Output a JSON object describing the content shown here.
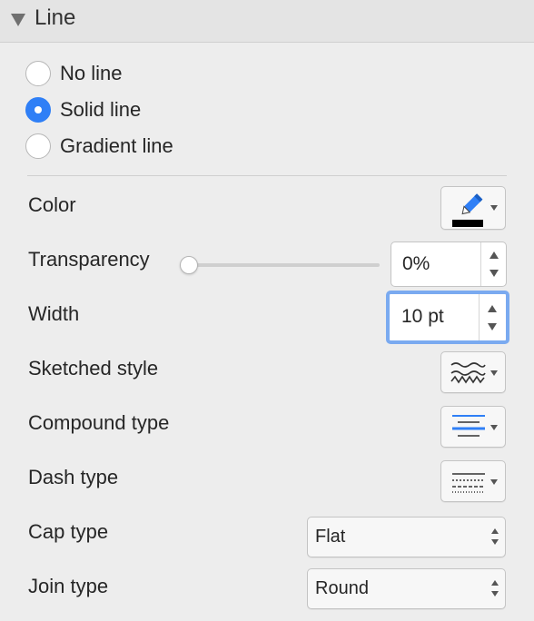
{
  "section": {
    "title": "Line"
  },
  "line_options": [
    {
      "label": "No line",
      "checked": false
    },
    {
      "label": "Solid line",
      "checked": true
    },
    {
      "label": "Gradient line",
      "checked": false
    }
  ],
  "color": {
    "label": "Color",
    "icon": "pen-icon",
    "value": "#000000"
  },
  "transparency": {
    "label": "Transparency",
    "value": "0%",
    "slider_fraction": 0.0
  },
  "width": {
    "label": "Width",
    "value": "10 pt"
  },
  "sketched": {
    "label": "Sketched style",
    "icon": "squiggle-lines-icon"
  },
  "compound": {
    "label": "Compound type",
    "icon": "compound-lines-icon"
  },
  "dash": {
    "label": "Dash type",
    "icon": "dash-lines-icon"
  },
  "cap": {
    "label": "Cap type",
    "value": "Flat"
  },
  "join": {
    "label": "Join type",
    "value": "Round"
  },
  "colors": {
    "accent": "#2f7ff6",
    "focus_ring": "#7aaaf0"
  }
}
